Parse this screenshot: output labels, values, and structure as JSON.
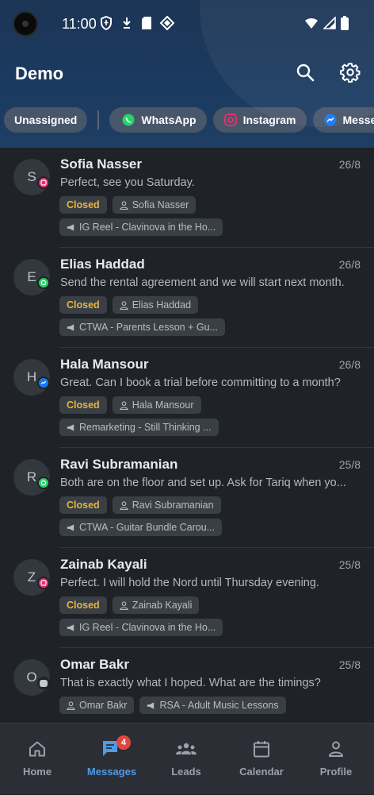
{
  "status_bar": {
    "time": "11:00"
  },
  "app": {
    "title": "Demo"
  },
  "channel_filters": [
    {
      "label": "Unassigned",
      "icon": "none"
    },
    {
      "label": "WhatsApp",
      "icon": "whatsapp-icon",
      "color": "#25d366"
    },
    {
      "label": "Instagram",
      "icon": "instagram-icon",
      "color": "#e1306c"
    },
    {
      "label": "Messenger",
      "icon": "messenger-icon",
      "color": "#1877f2"
    }
  ],
  "conversations": [
    {
      "initial": "S",
      "name": "Sofia Nasser",
      "date": "26/8",
      "message": "Perfect, see you Saturday.",
      "status": "Closed",
      "assignee": "Sofia Nasser",
      "campaign": "IG Reel - Clavinova in the Ho...",
      "channel": "instagram"
    },
    {
      "initial": "E",
      "name": "Elias Haddad",
      "date": "26/8",
      "message": "Send the rental agreement and we will start next month.",
      "status": "Closed",
      "assignee": "Elias Haddad",
      "campaign": "CTWA - Parents Lesson + Gu...",
      "channel": "whatsapp"
    },
    {
      "initial": "H",
      "name": "Hala Mansour",
      "date": "26/8",
      "message": "Great. Can I book a trial before committing to a month?",
      "status": "Closed",
      "assignee": "Hala Mansour",
      "campaign": "Remarketing - Still Thinking ...",
      "channel": "messenger"
    },
    {
      "initial": "R",
      "name": "Ravi Subramanian",
      "date": "25/8",
      "message": "Both are on the floor and set up. Ask for Tariq when yo...",
      "status": "Closed",
      "assignee": "Ravi Subramanian",
      "campaign": "CTWA - Guitar Bundle Carou...",
      "channel": "whatsapp"
    },
    {
      "initial": "Z",
      "name": "Zainab Kayali",
      "date": "25/8",
      "message": "Perfect. I will hold the Nord until Thursday evening.",
      "status": "Closed",
      "assignee": "Zainab Kayali",
      "campaign": "IG Reel - Clavinova in the Ho...",
      "channel": "instagram"
    },
    {
      "initial": "O",
      "name": "Omar Bakr",
      "date": "25/8",
      "message": "That is exactly what I hoped. What are the timings?",
      "status": "",
      "assignee": "Omar Bakr",
      "campaign": "RSA - Adult Music Lessons",
      "channel": "sms"
    }
  ],
  "bottom_nav": {
    "home": "Home",
    "messages": "Messages",
    "messages_badge": "4",
    "leads": "Leads",
    "calendar": "Calendar",
    "profile": "Profile"
  },
  "colors": {
    "accent": "#4f9be8",
    "closed_status": "#e8b53a",
    "badge": "#e0483f",
    "whatsapp": "#25d366",
    "instagram": "#e1306c",
    "messenger": "#1877f2"
  }
}
